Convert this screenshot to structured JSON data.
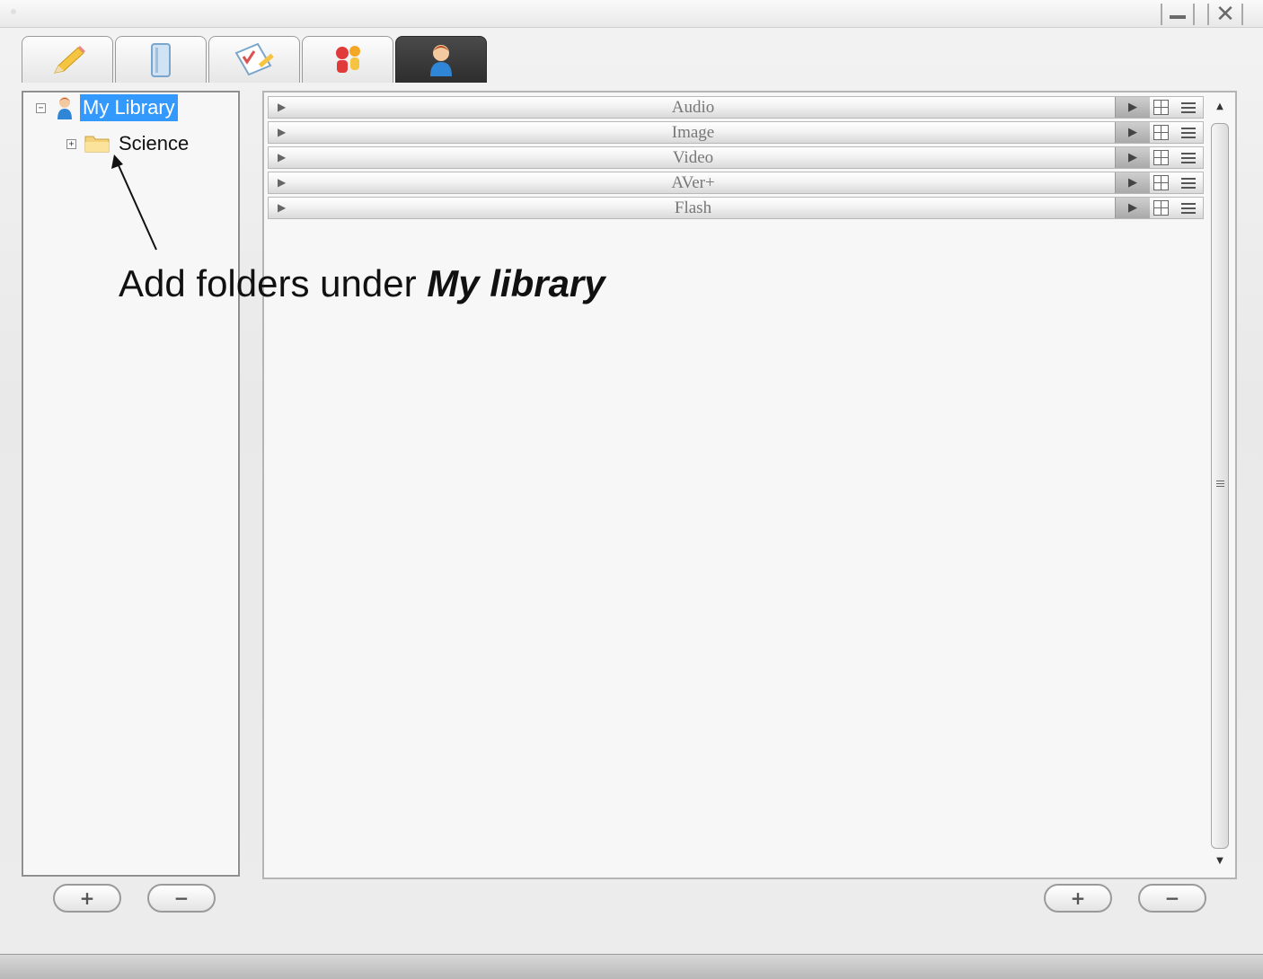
{
  "window": {
    "minimize_icon": "minimize-icon",
    "close_icon": "close-icon"
  },
  "tabs": [
    {
      "icon": "pencil-icon",
      "active": false
    },
    {
      "icon": "book-icon",
      "active": false
    },
    {
      "icon": "checklist-icon",
      "active": false
    },
    {
      "icon": "people-icon",
      "active": false
    },
    {
      "icon": "user-icon",
      "active": true
    }
  ],
  "tree": {
    "root": {
      "label": "My Library",
      "expander": "⊟",
      "icon": "user-icon",
      "selected": true
    },
    "children": [
      {
        "label": "Science",
        "expander": "⊞",
        "icon": "folder-icon"
      }
    ]
  },
  "categories": [
    {
      "label": "Audio"
    },
    {
      "label": "Image"
    },
    {
      "label": "Video"
    },
    {
      "label": "AVer+"
    },
    {
      "label": "Flash"
    }
  ],
  "tree_buttons": {
    "add": "+",
    "remove": "−"
  },
  "main_buttons": {
    "add": "+",
    "remove": "−"
  },
  "annotation": {
    "text": "Add folders under ",
    "emphasis": "My library"
  },
  "colors": {
    "selection": "#3399ff",
    "active_tab": "#2d2d2d"
  }
}
